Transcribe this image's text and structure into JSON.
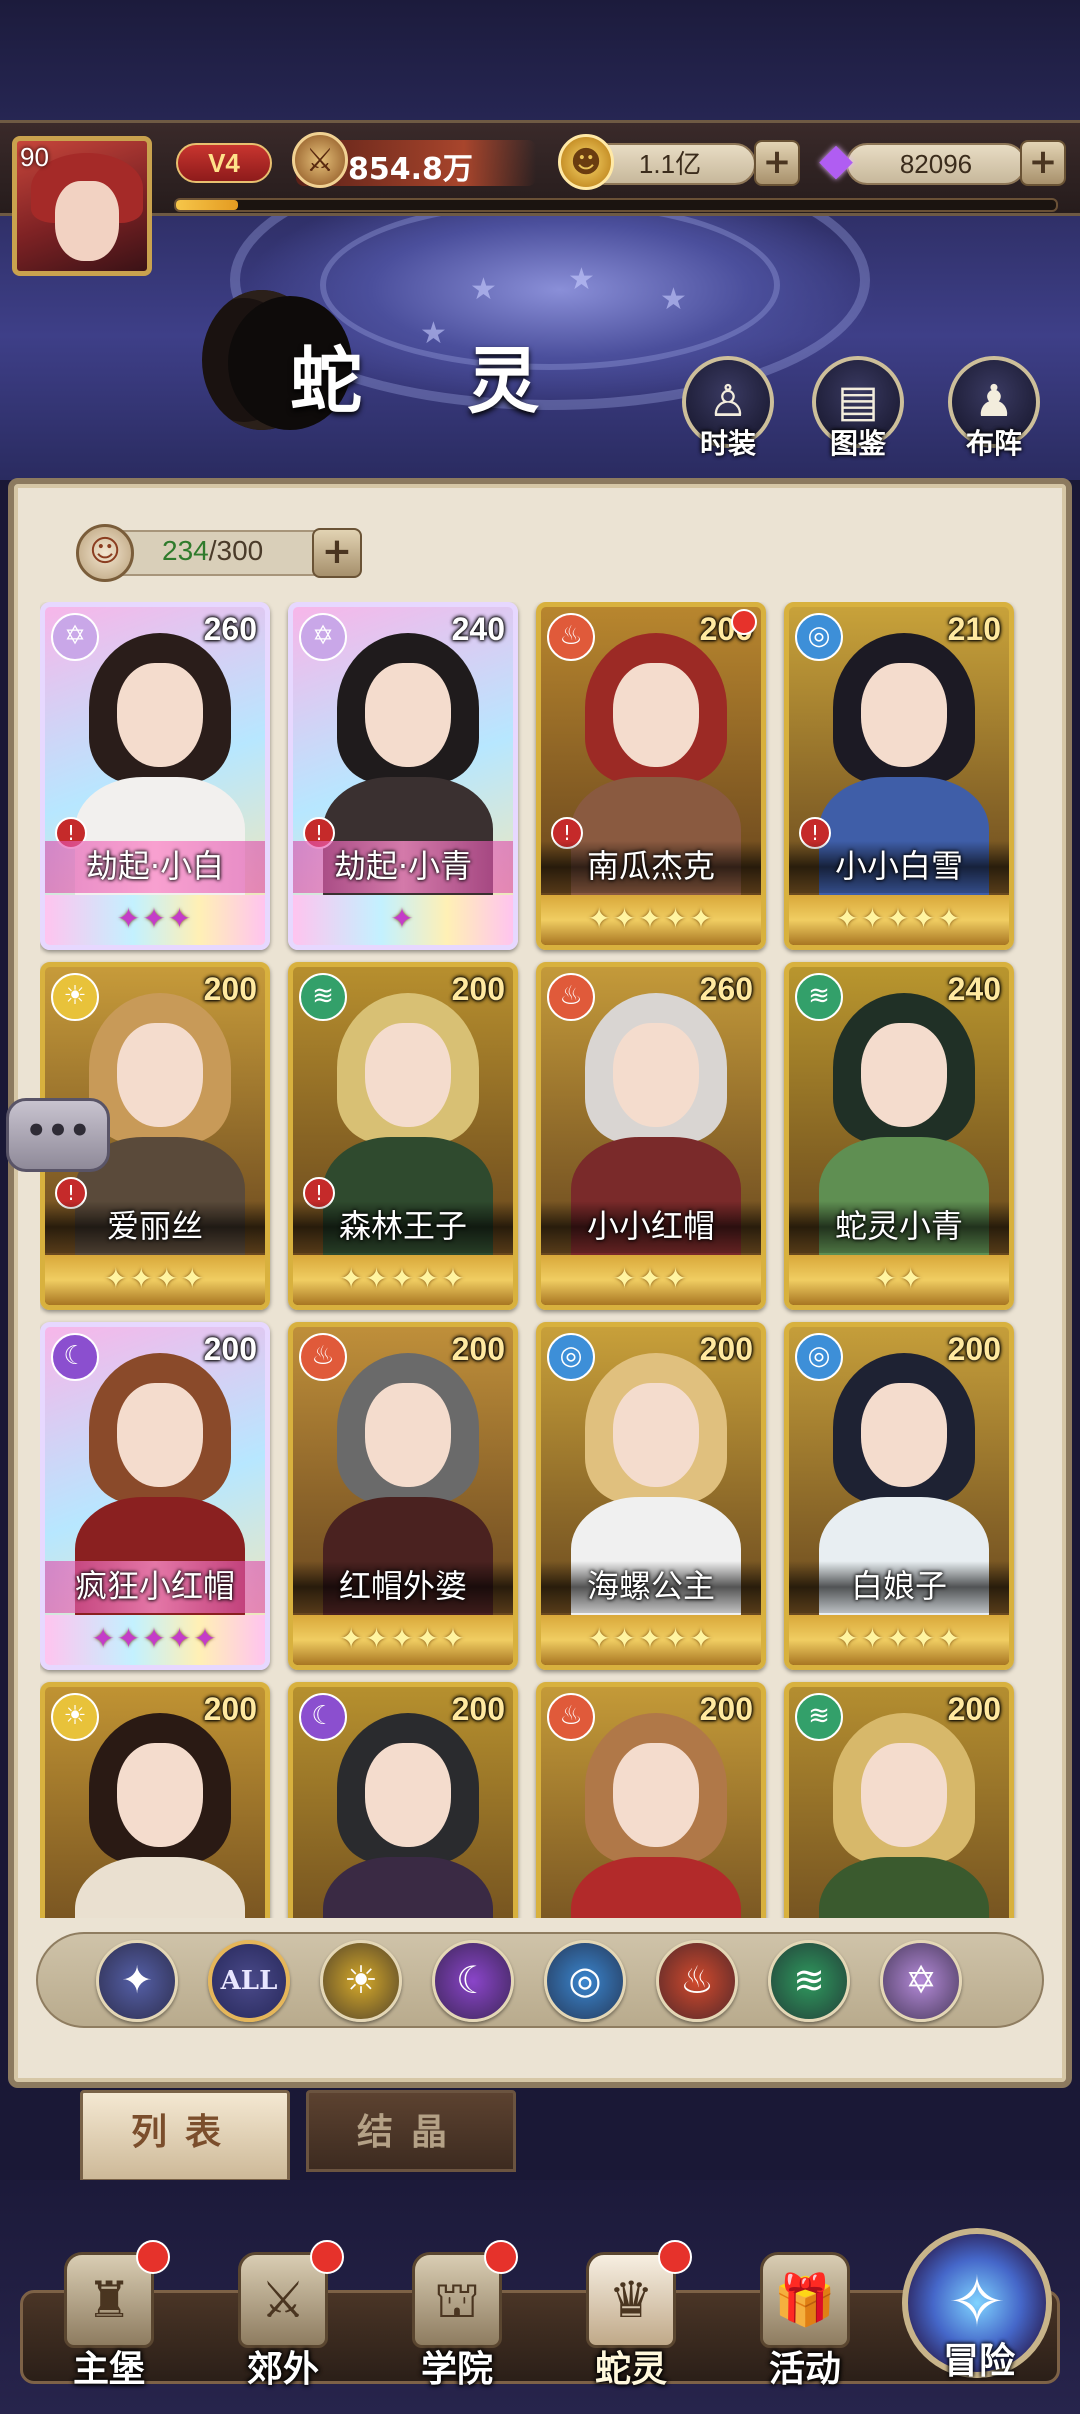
{
  "header": {
    "avatar_level": "90",
    "vip": "V4",
    "power": "854.8万",
    "gold": "1.1亿",
    "gems": "82096",
    "exp_progress": 0.07
  },
  "page": {
    "title": "蛇 灵",
    "buttons": [
      {
        "label": "时装",
        "icon": "costume-icon"
      },
      {
        "label": "图鉴",
        "icon": "codex-icon"
      },
      {
        "label": "布阵",
        "icon": "formation-icon"
      }
    ]
  },
  "roster": {
    "current": "234",
    "max": "300"
  },
  "cards": [
    {
      "name": "劫起·小白",
      "level": "260",
      "element": "star",
      "rarity": "rainbow",
      "stars": "✦✦✦",
      "dot": false,
      "mark": true
    },
    {
      "name": "劫起·小青",
      "level": "240",
      "element": "star",
      "rarity": "rainbow",
      "stars": "✦",
      "dot": false,
      "mark": true
    },
    {
      "name": "南瓜杰克",
      "level": "200",
      "element": "fire",
      "rarity": "gold",
      "stars": "✦✦✦✦✦",
      "dot": true,
      "mark": true
    },
    {
      "name": "小小白雪",
      "level": "210",
      "element": "water",
      "rarity": "gold",
      "stars": "✦✦✦✦✦",
      "dot": false,
      "mark": true
    },
    {
      "name": "爱丽丝",
      "level": "200",
      "element": "light",
      "rarity": "gold",
      "stars": "✦✦✦✦",
      "dot": false,
      "mark": true
    },
    {
      "name": "森林王子",
      "level": "200",
      "element": "wind",
      "rarity": "gold",
      "stars": "✦✦✦✦✦",
      "dot": false,
      "mark": true
    },
    {
      "name": "小小红帽",
      "level": "260",
      "element": "fire",
      "rarity": "gold",
      "stars": "✦✦✦",
      "dot": false,
      "mark": false
    },
    {
      "name": "蛇灵小青",
      "level": "240",
      "element": "wind",
      "rarity": "gold",
      "stars": "✦✦",
      "dot": false,
      "mark": false
    },
    {
      "name": "疯狂小红帽",
      "level": "200",
      "element": "dark",
      "rarity": "rainbow",
      "stars": "✦✦✦✦✦",
      "dot": false,
      "mark": false
    },
    {
      "name": "红帽外婆",
      "level": "200",
      "element": "fire",
      "rarity": "gold",
      "stars": "✦✦✦✦✦",
      "dot": false,
      "mark": false
    },
    {
      "name": "海螺公主",
      "level": "200",
      "element": "water",
      "rarity": "gold",
      "stars": "✦✦✦✦✦",
      "dot": false,
      "mark": false
    },
    {
      "name": "白娘子",
      "level": "200",
      "element": "water",
      "rarity": "gold",
      "stars": "✦✦✦✦✦",
      "dot": false,
      "mark": false
    },
    {
      "name": "",
      "level": "200",
      "element": "light",
      "rarity": "gold",
      "stars": "",
      "dot": false,
      "mark": false
    },
    {
      "name": "",
      "level": "200",
      "element": "dark",
      "rarity": "gold",
      "stars": "",
      "dot": false,
      "mark": false
    },
    {
      "name": "",
      "level": "200",
      "element": "fire",
      "rarity": "gold",
      "stars": "",
      "dot": false,
      "mark": false
    },
    {
      "name": "",
      "level": "200",
      "element": "wind",
      "rarity": "gold",
      "stars": "",
      "dot": false,
      "mark": false
    }
  ],
  "element_colors": {
    "star": "#c9a7e8",
    "fire": "#e05a3a",
    "water": "#3d8fd8",
    "light": "#e8c23a",
    "wind": "#33a06a",
    "dark": "#8b4fcf"
  },
  "filters": [
    {
      "id": "leader",
      "label": "",
      "icon": "leader-icon",
      "glyph": "✦",
      "color": "#5560a8"
    },
    {
      "id": "all",
      "label": "ALL",
      "icon": "all-icon",
      "glyph": "",
      "color": "#2f3069"
    },
    {
      "id": "light",
      "label": "",
      "icon": "light-element-icon",
      "glyph": "☀",
      "color": "#d6aa2a"
    },
    {
      "id": "dark",
      "label": "",
      "icon": "dark-element-icon",
      "glyph": "☾",
      "color": "#8a45c9"
    },
    {
      "id": "water",
      "label": "",
      "icon": "water-element-icon",
      "glyph": "◎",
      "color": "#3a86cf"
    },
    {
      "id": "fire",
      "label": "",
      "icon": "fire-element-icon",
      "glyph": "♨",
      "color": "#d24a2c"
    },
    {
      "id": "wind",
      "label": "",
      "icon": "wind-element-icon",
      "glyph": "≋",
      "color": "#2f9a5e"
    },
    {
      "id": "star",
      "label": "",
      "icon": "star-element-icon",
      "glyph": "✡",
      "color": "#b48ad8"
    }
  ],
  "tabs": {
    "list": "列表",
    "crystal": "结晶"
  },
  "chat_glyph": "•••",
  "nav": [
    {
      "label": "主堡",
      "icon": "castle-icon",
      "glyph": "♜",
      "badge": true,
      "active": false
    },
    {
      "label": "郊外",
      "icon": "swords-icon",
      "glyph": "⚔",
      "badge": true,
      "active": false
    },
    {
      "label": "学院",
      "icon": "academy-icon",
      "glyph": "⛫",
      "badge": true,
      "active": false
    },
    {
      "label": "蛇灵",
      "icon": "snake-spirit-icon",
      "glyph": "♛",
      "badge": true,
      "active": true
    },
    {
      "label": "活动",
      "icon": "gift-icon",
      "glyph": "🎁",
      "badge": false,
      "active": false
    }
  ],
  "adventure": {
    "label": "冒险",
    "glyph": "✧"
  }
}
